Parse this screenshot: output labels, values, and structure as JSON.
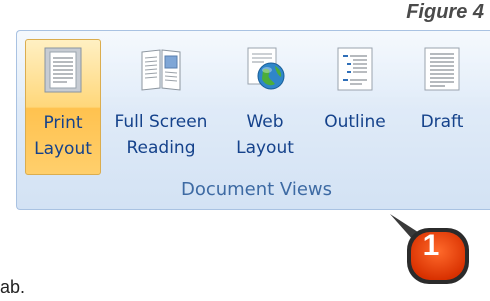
{
  "figure_label": "Figure 4",
  "ribbon": {
    "group_label": "Document Views",
    "buttons": [
      {
        "line1": "Print",
        "line2": "Layout",
        "icon": "print-layout-icon",
        "active": true
      },
      {
        "line1": "Full Screen",
        "line2": "Reading",
        "icon": "full-screen-reading-icon"
      },
      {
        "line1": "Web",
        "line2": "Layout",
        "icon": "web-layout-icon"
      },
      {
        "line1": "Outline",
        "line2": "",
        "icon": "outline-icon"
      },
      {
        "line1": "Draft",
        "line2": "",
        "icon": "draft-icon"
      }
    ]
  },
  "callout": {
    "number": "1",
    "color": "#e63b00"
  },
  "footer_text": "ab."
}
